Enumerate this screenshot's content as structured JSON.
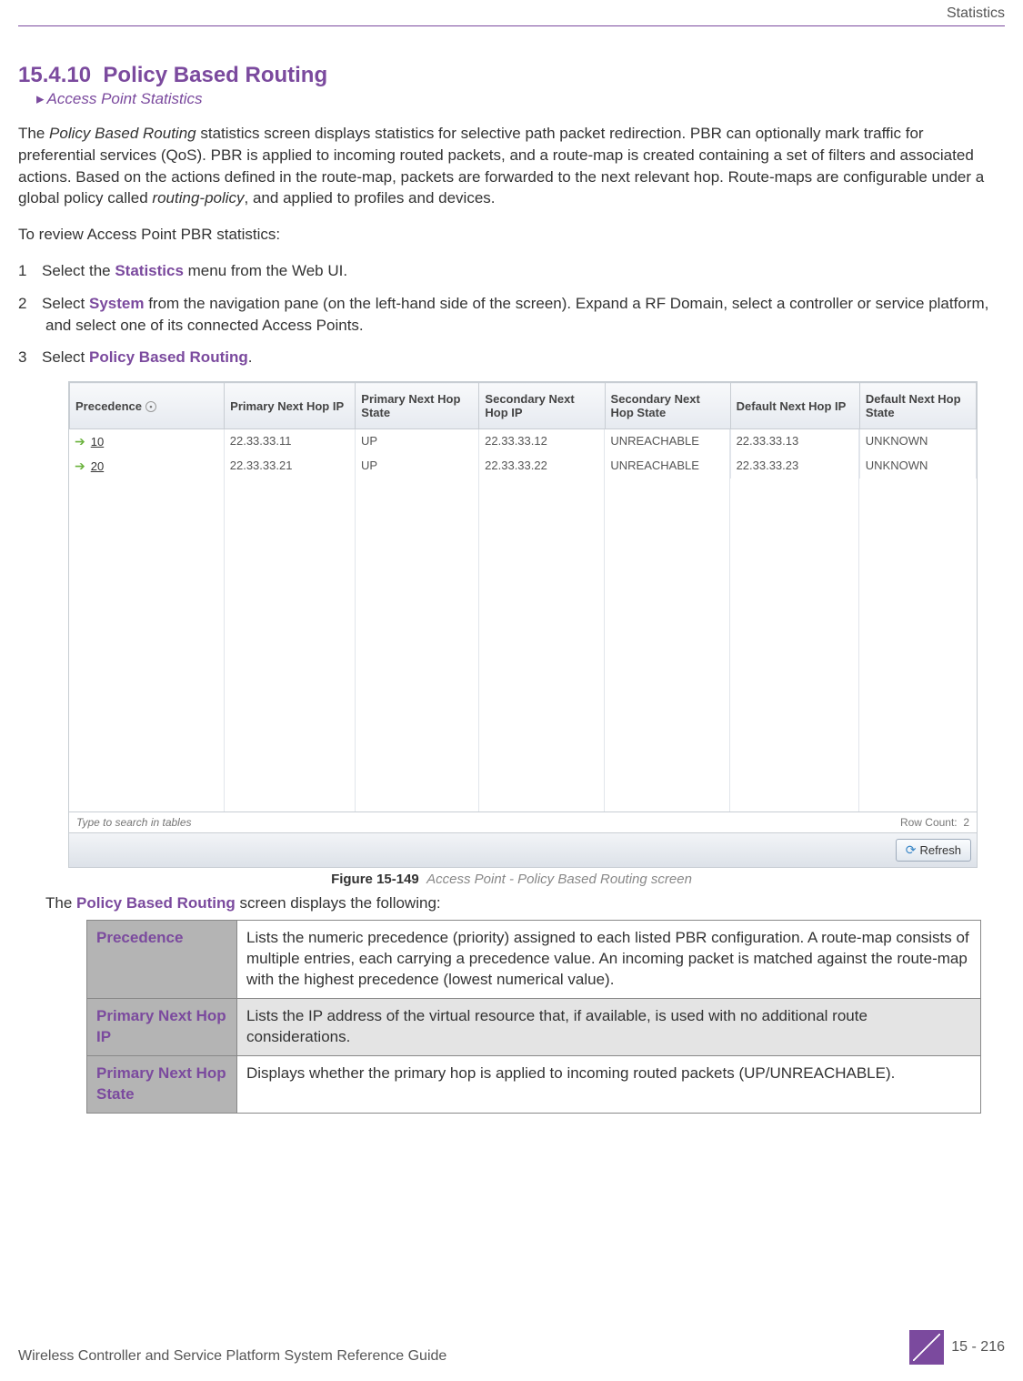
{
  "header": {
    "chapter": "Statistics"
  },
  "section": {
    "number": "15.4.10",
    "title": "Policy Based Routing",
    "breadcrumb": "Access Point Statistics"
  },
  "intro": {
    "p1_a": "The ",
    "p1_em1": "Policy Based Routing",
    "p1_b": " statistics screen displays statistics for selective path packet redirection. PBR can optionally mark traffic for preferential services (QoS). PBR is applied to incoming routed packets, and a route-map is created containing a set of filters and associated actions. Based on the actions defined in the route-map, packets are forwarded to the next relevant hop. Route-maps are configurable under a global policy called ",
    "p1_em2": "routing-policy",
    "p1_c": ", and applied to profiles and devices.",
    "p2": "To review Access Point PBR statistics:"
  },
  "steps": [
    {
      "num": "1",
      "pre": "Select the ",
      "strong": "Statistics",
      "post": " menu from the Web UI."
    },
    {
      "num": "2",
      "pre": "Select ",
      "strong": "System",
      "post": " from the navigation pane (on the left-hand side of the screen). Expand a RF Domain, select a controller or service platform, and select one of its connected Access Points."
    },
    {
      "num": "3",
      "pre": "Select ",
      "strong": "Policy Based Routing",
      "post": "."
    }
  ],
  "grid": {
    "columns": [
      "Precedence",
      "Primary Next Hop IP",
      "Primary Next Hop State",
      "Secondary Next Hop IP",
      "Secondary Next Hop State",
      "Default Next Hop IP",
      "Default Next Hop State"
    ],
    "rows": [
      {
        "precedence": "10",
        "primaryIP": "22.33.33.11",
        "primaryState": "UP",
        "secondaryIP": "22.33.33.12",
        "secondaryState": "UNREACHABLE",
        "defaultIP": "22.33.33.13",
        "defaultState": "UNKNOWN"
      },
      {
        "precedence": "20",
        "primaryIP": "22.33.33.21",
        "primaryState": "UP",
        "secondaryIP": "22.33.33.22",
        "secondaryState": "UNREACHABLE",
        "defaultIP": "22.33.33.23",
        "defaultState": "UNKNOWN"
      }
    ],
    "search_placeholder": "Type to search in tables",
    "row_count_label": "Row Count:",
    "row_count_value": "2",
    "refresh_label": "Refresh"
  },
  "figure": {
    "label": "Figure 15-149",
    "desc": "Access Point - Policy Based Routing screen"
  },
  "desc_intro_a": "The ",
  "desc_intro_strong": "Policy Based Routing",
  "desc_intro_b": " screen displays the following:",
  "desc_table": [
    {
      "label": "Precedence",
      "text": "Lists the numeric precedence (priority) assigned to each listed PBR configuration. A route-map consists of multiple entries, each carrying a precedence value. An incoming packet is matched against the route-map with the highest precedence (lowest numerical value)."
    },
    {
      "label": "Primary Next Hop IP",
      "text": "Lists the IP address of the virtual resource that, if available, is used with no additional route considerations."
    },
    {
      "label": "Primary Next Hop State",
      "text": "Displays whether the primary hop is applied to incoming routed packets (UP/UNREACHABLE)."
    }
  ],
  "footer": {
    "guide": "Wireless Controller and Service Platform System Reference Guide",
    "page": "15 - 216"
  }
}
